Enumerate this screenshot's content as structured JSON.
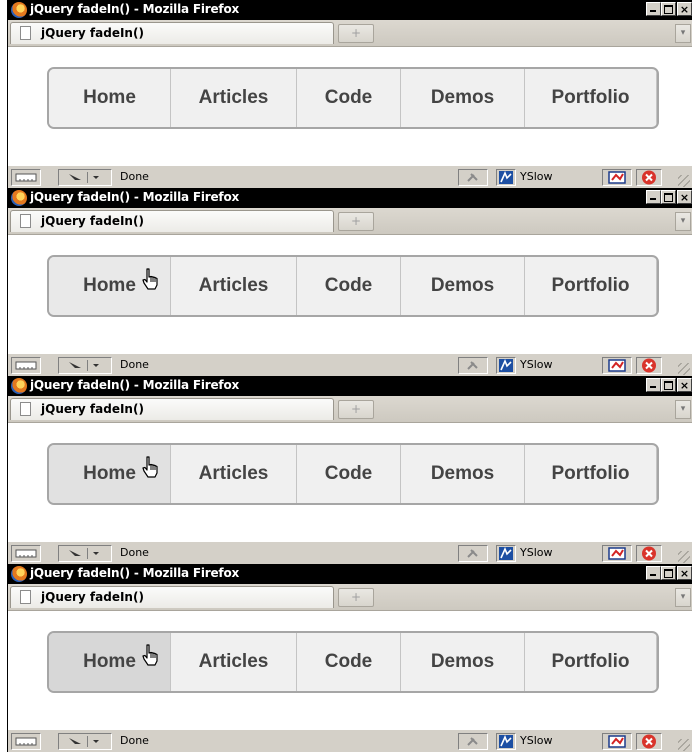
{
  "colors": {
    "titlebar_bg": "#000000",
    "nav_border": "#a6a6a6",
    "nav_bg": "#f0f0f0",
    "nav_text": "#444444",
    "hover_fade_steps": [
      "#f0f0f0",
      "#e9e9e9",
      "#e1e1e1",
      "#d7d7d7"
    ]
  },
  "window": {
    "title": "jQuery fadeIn() - Mozilla Firefox",
    "tab_label": "jQuery fadeIn()",
    "new_tab_glyph": "+",
    "tab_list_glyph": "▾",
    "min_glyph": "",
    "max_glyph": "",
    "close_glyph": "×"
  },
  "nav": {
    "items": [
      "Home",
      "Articles",
      "Code",
      "Demos",
      "Portfolio"
    ]
  },
  "statusbar": {
    "status_text": "Done",
    "addon_label": "YSlow"
  },
  "frames": [
    {
      "hover": false
    },
    {
      "hover": true
    },
    {
      "hover": true
    },
    {
      "hover": true
    }
  ]
}
